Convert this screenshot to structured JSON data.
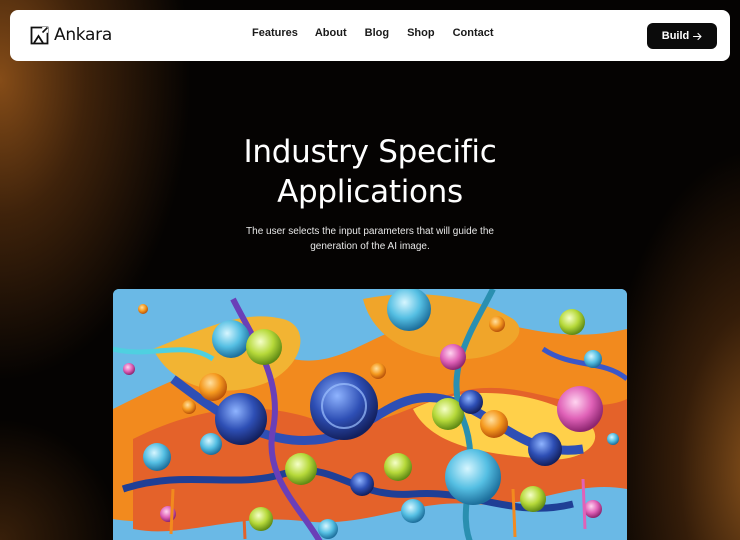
{
  "brand": {
    "name": "Ankara",
    "logo_icon": "image-frame-icon"
  },
  "nav": {
    "items": [
      {
        "label": "Features"
      },
      {
        "label": "About"
      },
      {
        "label": "Blog"
      },
      {
        "label": "Shop"
      },
      {
        "label": "Contact"
      }
    ],
    "cta_label": "Build",
    "cta_icon": "arrow-right-icon"
  },
  "hero": {
    "title_line1": "Industry Specific",
    "title_line2": "Applications",
    "subtitle": "The user selects the input parameters that will guide the generation of the AI image."
  },
  "colors": {
    "background": "#050302",
    "glow": "#8c5019",
    "navbar": "#ffffff",
    "button": "#0b0b0b",
    "text_light": "#ffffff"
  }
}
